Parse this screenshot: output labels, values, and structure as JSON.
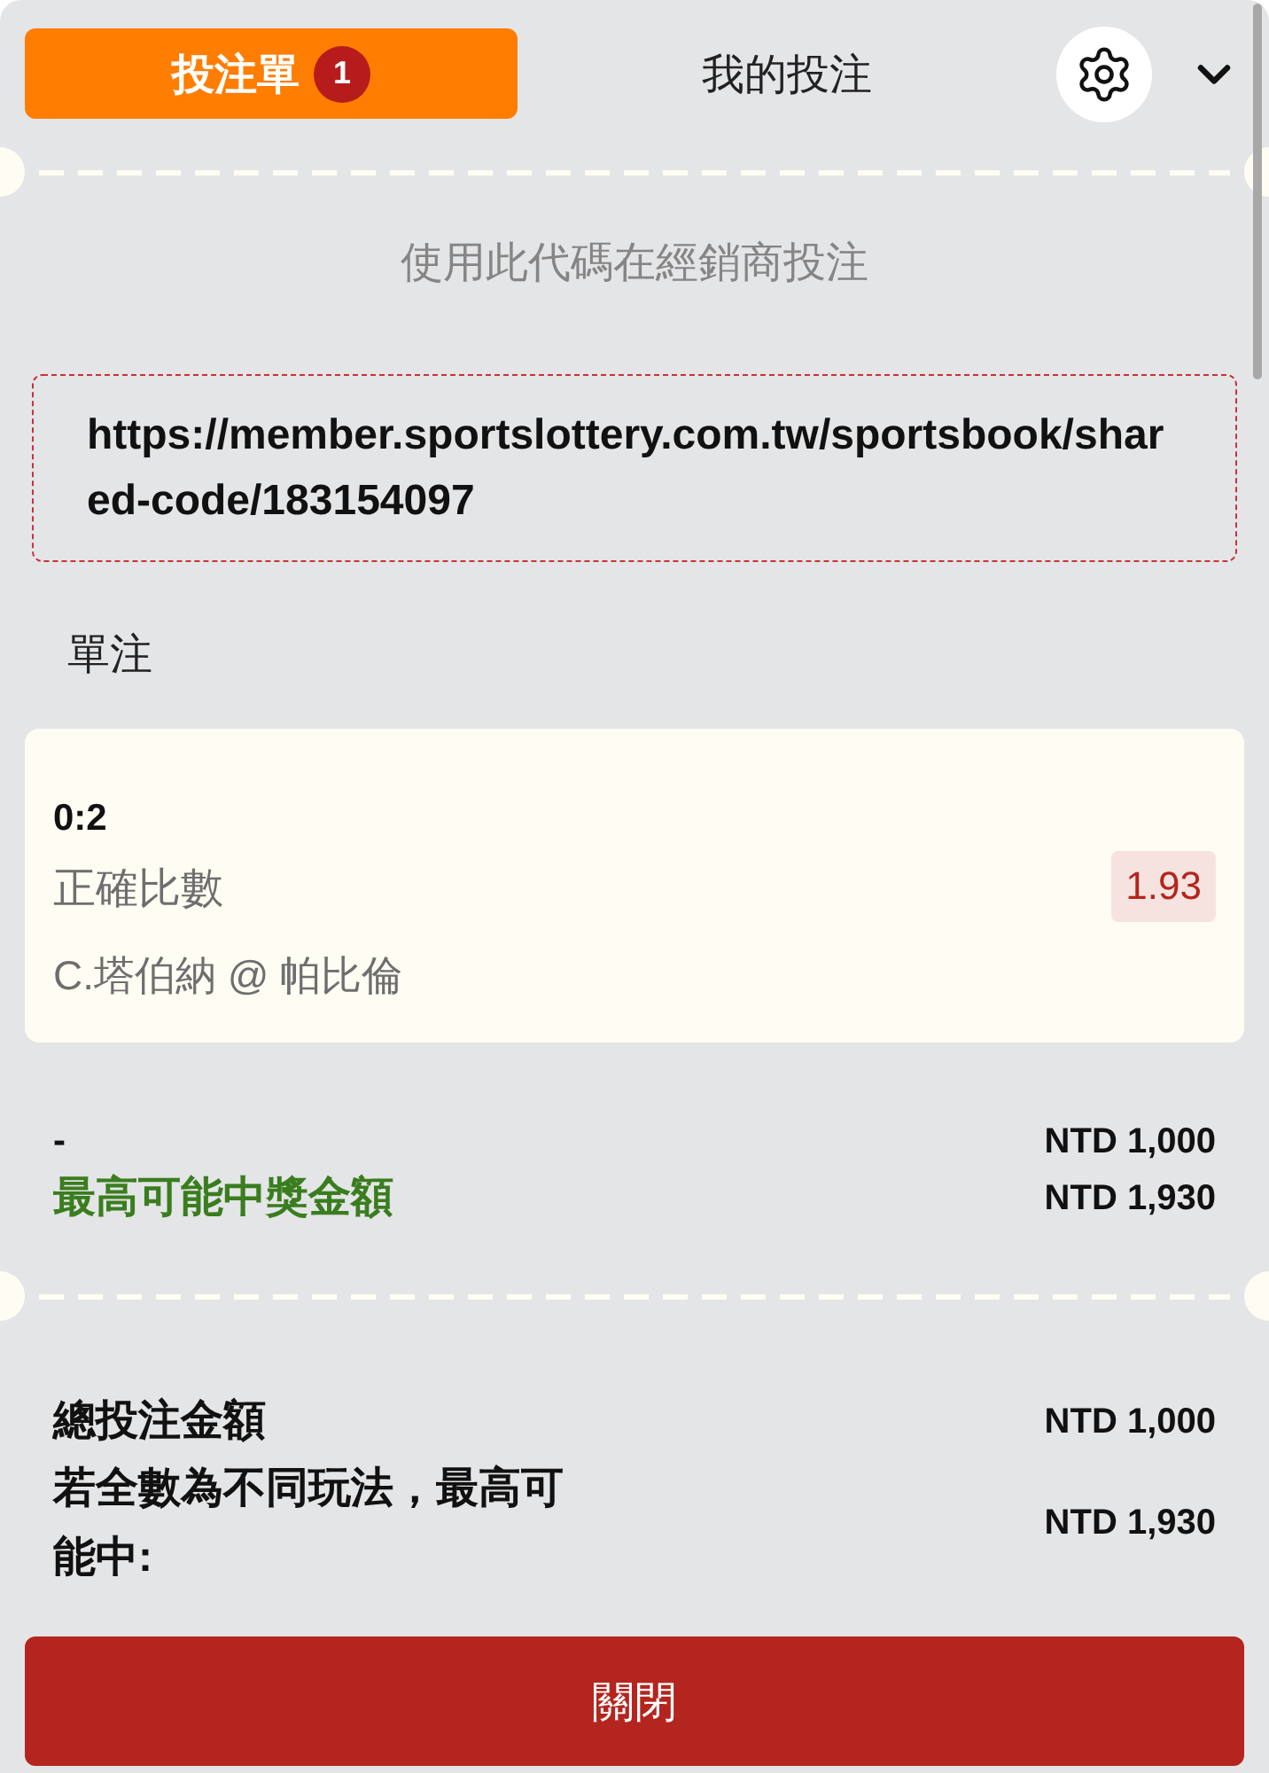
{
  "tabs": [
    {
      "label": "投注單",
      "badge": "1",
      "selected": true
    },
    {
      "label": "我的投注",
      "selected": false
    }
  ],
  "share": {
    "instruction": "使用此代碼在經銷商投注",
    "code_url": "https://member.sportslottery.com.tw/sportsbook/shared-code/183154097"
  },
  "section_title": "單注",
  "bets": [
    {
      "selection": "0:2",
      "market": "正確比數",
      "event": "C.塔伯納 @ 帕比倫",
      "odds": "1.93"
    }
  ],
  "stake": {
    "label": "-",
    "amount": "NTD 1,000"
  },
  "potential_win": {
    "label": "最高可能中獎金額",
    "amount": "NTD 1,930"
  },
  "totals": [
    {
      "label": "總投注金額",
      "amount": "NTD 1,000"
    },
    {
      "label": "若全數為不同玩法，最高可能中:",
      "amount": "NTD 1,930"
    }
  ],
  "close_button": "關閉"
}
